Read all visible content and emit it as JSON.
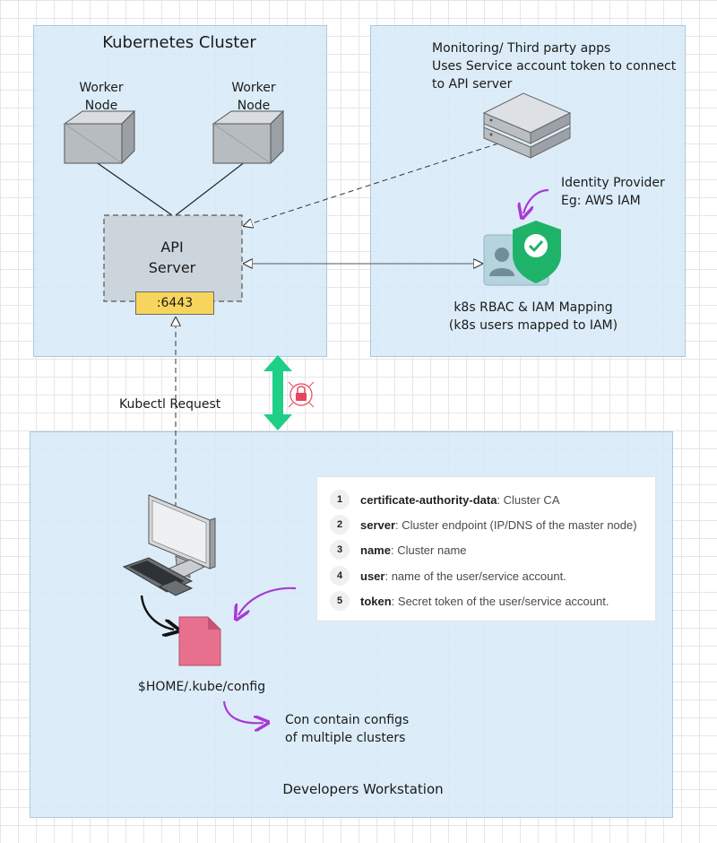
{
  "panels": {
    "cluster_title": "Kubernetes Cluster",
    "workstation_title": "Developers Workstation"
  },
  "cluster": {
    "worker_left": "Worker\nNode",
    "worker_right": "Worker\nNode",
    "api_server": "API\nServer",
    "port": ":6443"
  },
  "external": {
    "monitoring": "Monitoring/ Third party apps\nUses Service account token to connect\nto API server",
    "identity_provider": "Identity Provider\nEg: AWS IAM",
    "rbac_mapping": "k8s RBAC & IAM Mapping\n(k8s users mapped to IAM)"
  },
  "connection": {
    "kubectl_request": "Kubectl Request"
  },
  "workstation": {
    "config_path": "$HOME/.kube/config",
    "config_note": "Con contain configs\nof multiple clusters",
    "config_fields": [
      {
        "num": "1",
        "term": "certificate-authority-data",
        "desc": ": Cluster CA"
      },
      {
        "num": "2",
        "term": "server",
        "desc": ": Cluster endpoint (IP/DNS of the master node)"
      },
      {
        "num": "3",
        "term": "name",
        "desc": ": Cluster name"
      },
      {
        "num": "4",
        "term": "user",
        "desc": ": name of the user/service account."
      },
      {
        "num": "5",
        "term": "token",
        "desc": ": Secret token of the user/service account."
      }
    ]
  },
  "colors": {
    "panel_fill": "#d6eaf8",
    "api_box_fill": "#cdd5dc",
    "port_fill": "#f7d55c",
    "secure_arrow": "#1fcf85",
    "purple_arrow": "#a93ad6",
    "file_icon": "#e8708f",
    "shield": "#1fb36a"
  }
}
